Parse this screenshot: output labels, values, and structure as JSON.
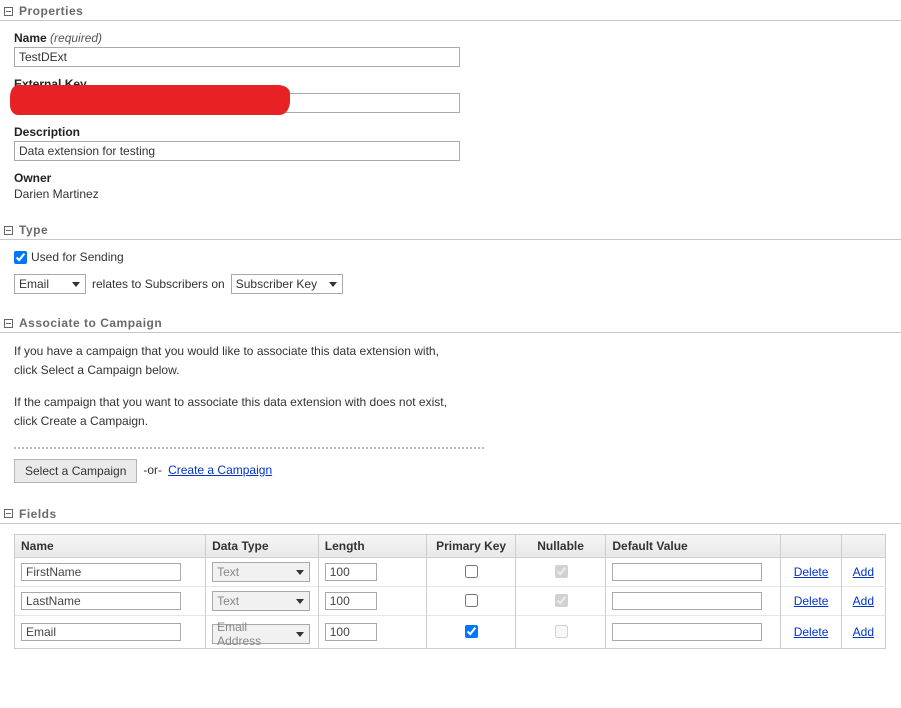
{
  "sections": {
    "properties": {
      "title": "Properties"
    },
    "type": {
      "title": "Type"
    },
    "associate": {
      "title": "Associate to Campaign"
    },
    "fields": {
      "title": "Fields"
    }
  },
  "properties": {
    "name_label": "Name",
    "name_req": "(required)",
    "name_value": "TestDExt",
    "external_key_label": "External Key",
    "external_key_value": "",
    "description_label": "Description",
    "description_value": "Data extension for testing",
    "owner_label": "Owner",
    "owner_value": "Darien Martinez"
  },
  "type": {
    "sending_label": "Used for Sending",
    "sending_checked": true,
    "channel_selected": "Email",
    "relates_text": "relates to Subscribers on",
    "subscriber_selected": "Subscriber Key"
  },
  "associate": {
    "line1": "If you have a campaign that you would like to associate this data extension with,",
    "line2": "click Select a Campaign below.",
    "line3": "If the campaign that you want to associate this data extension with does not exist,",
    "line4": "click Create a Campaign.",
    "select_btn": "Select a Campaign",
    "or_text": "-or-",
    "create_link": "Create a Campaign"
  },
  "fields_table": {
    "headers": {
      "name": "Name",
      "data_type": "Data Type",
      "length": "Length",
      "primary_key": "Primary Key",
      "nullable": "Nullable",
      "default_value": "Default Value"
    },
    "delete_label": "Delete",
    "add_label": "Add",
    "rows": [
      {
        "name": "FirstName",
        "data_type": "Text",
        "length": "100",
        "primary_key": false,
        "nullable": true,
        "default_value": ""
      },
      {
        "name": "LastName",
        "data_type": "Text",
        "length": "100",
        "primary_key": false,
        "nullable": true,
        "default_value": ""
      },
      {
        "name": "Email",
        "data_type": "Email Address",
        "length": "100",
        "primary_key": true,
        "nullable": false,
        "default_value": ""
      }
    ]
  }
}
